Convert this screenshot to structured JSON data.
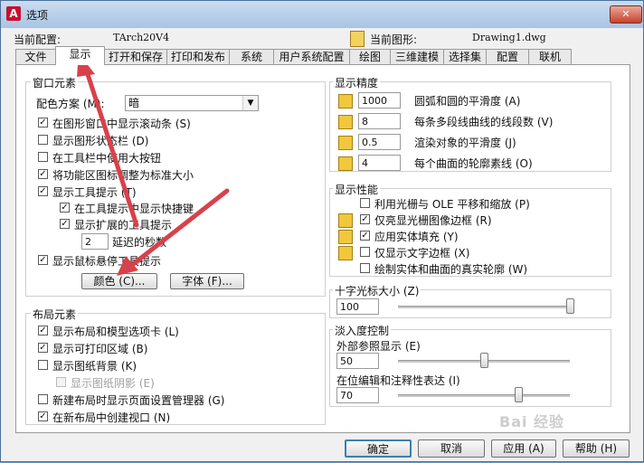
{
  "window": {
    "title": "选项",
    "app_icon": "A",
    "close_glyph": "✕"
  },
  "info": {
    "current_config_label": "当前配置:",
    "current_config_value": "TArch20V4",
    "current_drawing_label": "当前图形:",
    "current_drawing_value": "Drawing1.dwg"
  },
  "tabs": [
    {
      "label": "文件"
    },
    {
      "label": "显示"
    },
    {
      "label": "打开和保存"
    },
    {
      "label": "打印和发布"
    },
    {
      "label": "系统"
    },
    {
      "label": "用户系统配置"
    },
    {
      "label": "绘图"
    },
    {
      "label": "三维建模"
    },
    {
      "label": "选择集"
    },
    {
      "label": "配置"
    },
    {
      "label": "联机"
    }
  ],
  "window_elements": {
    "title": "窗口元素",
    "color_scheme_label": "配色方案 (M):",
    "color_scheme_value": "暗",
    "checks": [
      {
        "label": "在图形窗口中显示滚动条 (S)",
        "checked": true
      },
      {
        "label": "显示图形状态栏 (D)",
        "checked": false
      },
      {
        "label": "在工具栏中使用大按钮",
        "checked": false
      },
      {
        "label": "将功能区图标调整为标准大小",
        "checked": true
      },
      {
        "label": "显示工具提示 (T)",
        "checked": true
      },
      {
        "label": "在工具提示中显示快捷键",
        "checked": true
      },
      {
        "label": "显示扩展的工具提示",
        "checked": true
      },
      {
        "label": "显示鼠标悬停工具提示",
        "checked": true
      }
    ],
    "delay_value": "2",
    "delay_label": "延迟的秒数",
    "colors_button": "颜色 (C)...",
    "fonts_button": "字体 (F)..."
  },
  "layout_elements": {
    "title": "布局元素",
    "checks": [
      {
        "label": "显示布局和模型选项卡 (L)",
        "checked": true
      },
      {
        "label": "显示可打印区域 (B)",
        "checked": true
      },
      {
        "label": "显示图纸背景 (K)",
        "checked": false
      },
      {
        "label": "显示图纸阴影 (E)",
        "checked": false,
        "disabled": true
      },
      {
        "label": "新建布局时显示页面设置管理器 (G)",
        "checked": false
      },
      {
        "label": "在新布局中创建视口 (N)",
        "checked": true
      }
    ]
  },
  "display_resolution": {
    "title": "显示精度",
    "rows": [
      {
        "value": "1000",
        "label": "圆弧和圆的平滑度 (A)"
      },
      {
        "value": "8",
        "label": "每条多段线曲线的线段数 (V)"
      },
      {
        "value": "0.5",
        "label": "渲染对象的平滑度 (J)"
      },
      {
        "value": "4",
        "label": "每个曲面的轮廓素线 (O)"
      }
    ]
  },
  "display_performance": {
    "title": "显示性能",
    "checks": [
      {
        "label": "利用光栅与 OLE 平移和缩放 (P)",
        "checked": false
      },
      {
        "label": "仅亮显光栅图像边框 (R)",
        "checked": true
      },
      {
        "label": "应用实体填充 (Y)",
        "checked": true
      },
      {
        "label": "仅显示文字边框 (X)",
        "checked": false
      },
      {
        "label": "绘制实体和曲面的真实轮廓 (W)",
        "checked": false
      }
    ]
  },
  "crosshair": {
    "title": "十字光标大小 (Z)",
    "value": "100",
    "level": 1.0
  },
  "fade": {
    "title": "淡入度控制",
    "xref_label": "外部参照显示 (E)",
    "xref_value": "50",
    "xref_level": 0.5,
    "inplace_label": "在位编辑和注释性表达 (I)",
    "inplace_value": "70",
    "inplace_level": 0.7
  },
  "watermark": "Bai 经验",
  "footer": {
    "ok": "确定",
    "cancel": "取消",
    "apply": "应用 (A)",
    "help": "帮助 (H)"
  },
  "colors": {
    "arrow": "#d8414a",
    "accent_blue": "#3c7fb1",
    "field_icon": "#f1c73c"
  }
}
